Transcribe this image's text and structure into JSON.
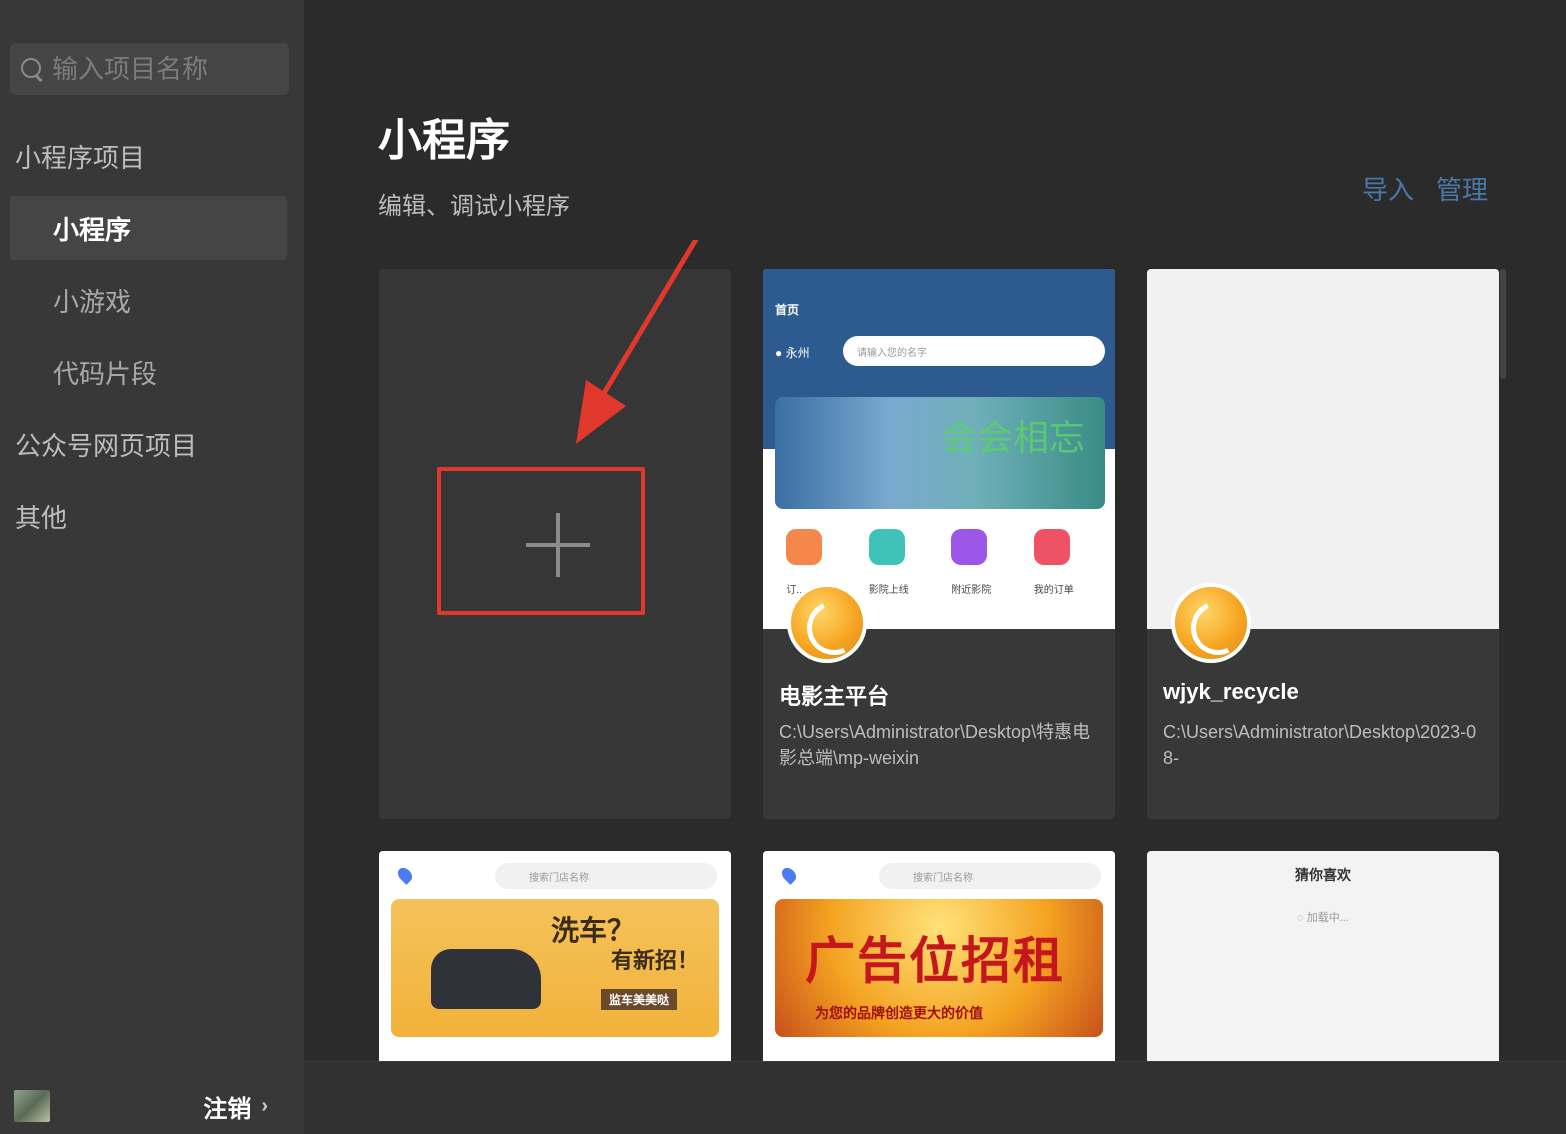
{
  "sidebar": {
    "search_placeholder": "输入项目名称",
    "sections": [
      {
        "label": "小程序项目"
      },
      {
        "label": "公众号网页项目"
      },
      {
        "label": "其他"
      }
    ],
    "items": [
      {
        "label": "小程序",
        "active": true
      },
      {
        "label": "小游戏",
        "active": false
      },
      {
        "label": "代码片段",
        "active": false
      }
    ],
    "footer": {
      "logout_label": "注销",
      "chevron": "›"
    }
  },
  "main": {
    "title": "小程序",
    "subtitle": "编辑、调试小程序",
    "actions": {
      "import_label": "导入",
      "manage_label": "管理"
    },
    "projects": [
      {
        "name": "电影主平台",
        "path": "C:\\Users\\Administrator\\Desktop\\特惠电影总端\\mp-weixin"
      },
      {
        "name": "wjyk_recycle",
        "path": "C:\\Users\\Administrator\\Desktop\\2023-08-"
      }
    ],
    "thumbs": {
      "movie": {
        "title": "首页",
        "location": "永州",
        "search_placeholder": "请输入您的名字",
        "banner_text": "会会相忘",
        "icon_labels": [
          "订..",
          "影院上线",
          "附近影院",
          "我的订单"
        ]
      },
      "carwash": {
        "search_placeholder": "搜索门店名称",
        "banner_line1": "洗车？",
        "banner_line2": "有新招！",
        "banner_tag": "监车美美哒"
      },
      "ads": {
        "search_placeholder": "搜索门店名称",
        "banner_text": "广告位招租",
        "banner_sub": "为您的品牌创造更大的价值"
      },
      "guess": {
        "title": "猜你喜欢",
        "loading": "加载中..."
      }
    }
  },
  "colors": {
    "accent": "#4a78a8",
    "highlight": "#e0382d",
    "sidebar_bg": "#383838",
    "main_bg": "#2b2b2b"
  }
}
